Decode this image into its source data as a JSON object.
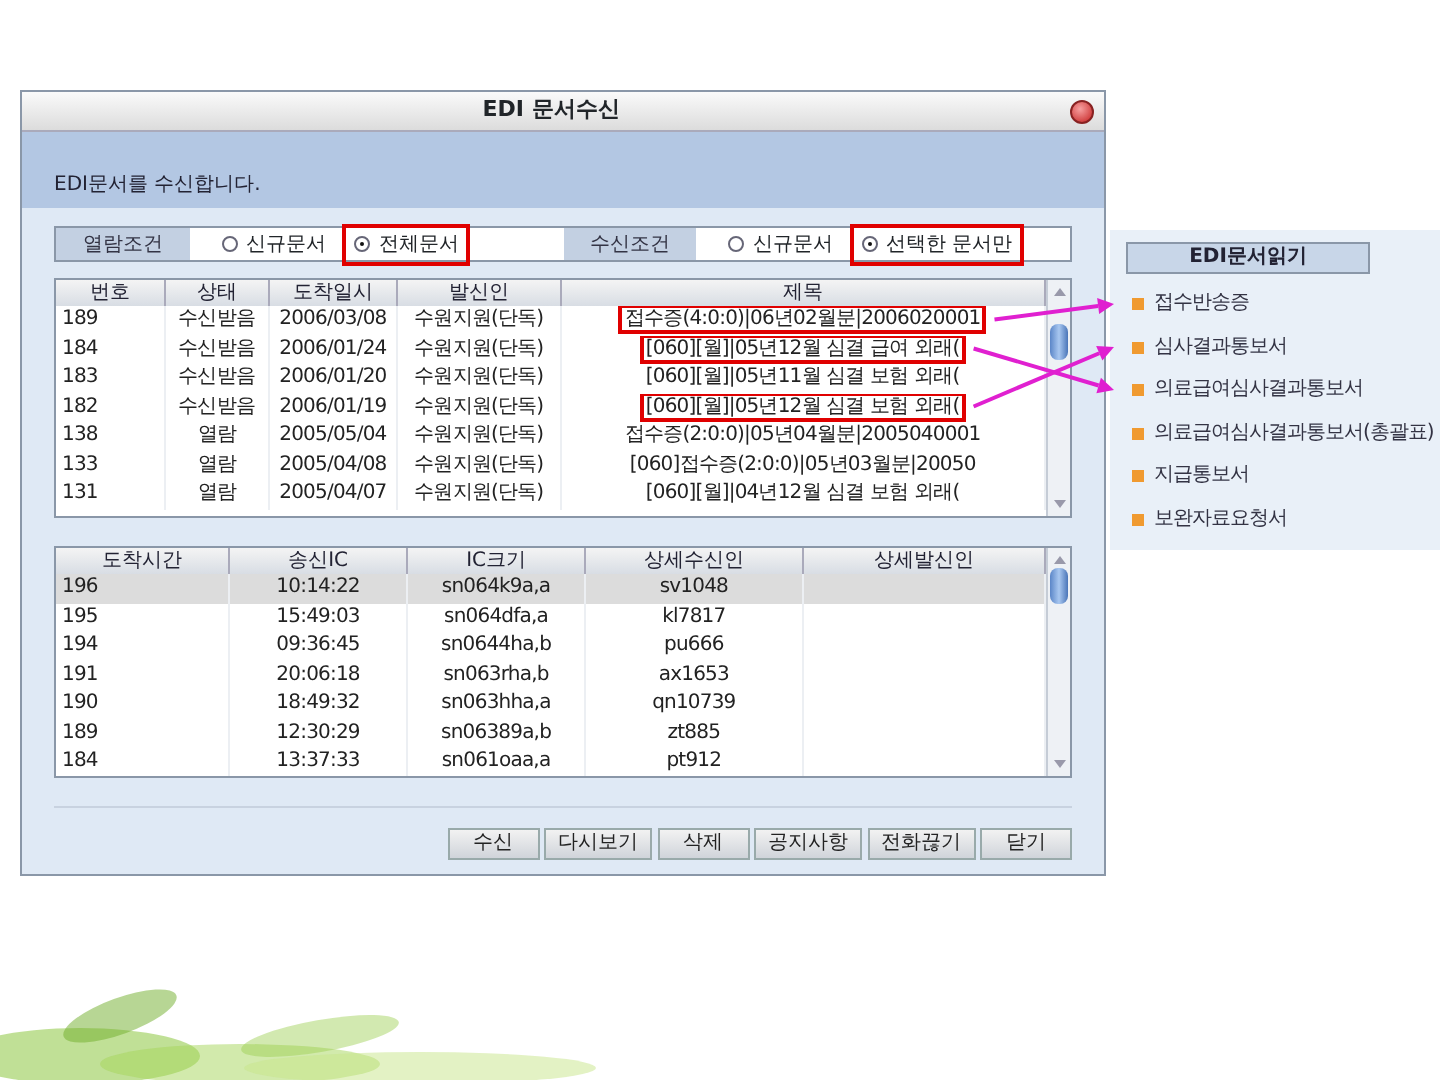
{
  "window": {
    "title": "EDI 문서수신"
  },
  "header": {
    "message": "EDI문서를 수신합니다."
  },
  "filters": [
    {
      "label": "열람조건",
      "options": [
        {
          "label": "신규문서",
          "selected": false,
          "highlighted": false
        },
        {
          "label": "전체문서",
          "selected": true,
          "highlighted": true
        }
      ]
    },
    {
      "label": "수신조건",
      "options": [
        {
          "label": "신규문서",
          "selected": false,
          "highlighted": false
        },
        {
          "label": "선택한 문서만",
          "selected": true,
          "highlighted": true
        }
      ]
    }
  ],
  "documents_table": {
    "columns": [
      "번호",
      "상태",
      "도착일시",
      "발신인",
      "제목"
    ],
    "rows": [
      {
        "cells": [
          "189",
          "수신받음",
          "2006/03/08",
          "수원지원(단독)",
          "접수증(4:0:0)|06년02월분|2006020001"
        ],
        "highlighted": true
      },
      {
        "cells": [
          "184",
          "수신받음",
          "2006/01/24",
          "수원지원(단독)",
          "[060][월]|05년12월 심결 급여 외래("
        ],
        "highlighted": true
      },
      {
        "cells": [
          "183",
          "수신받음",
          "2006/01/20",
          "수원지원(단독)",
          "[060][월]|05년11월 심결 보험 외래("
        ],
        "highlighted": false
      },
      {
        "cells": [
          "182",
          "수신받음",
          "2006/01/19",
          "수원지원(단독)",
          "[060][월]|05년12월 심결 보험 외래("
        ],
        "highlighted": true
      },
      {
        "cells": [
          "138",
          "열람",
          "2005/05/04",
          "수원지원(단독)",
          "접수증(2:0:0)|05년04월분|2005040001"
        ],
        "highlighted": false
      },
      {
        "cells": [
          "133",
          "열람",
          "2005/04/08",
          "수원지원(단독)",
          "[060]접수증(2:0:0)|05년03월분|20050"
        ],
        "highlighted": false
      },
      {
        "cells": [
          "131",
          "열람",
          "2005/04/07",
          "수원지원(단독)",
          "[060][월]|04년12월 심결 보험 외래("
        ],
        "highlighted": false
      }
    ]
  },
  "detail_table": {
    "columns": [
      "도착시간",
      "송신IC",
      "IC크기",
      "상세수신인",
      "상세발신인"
    ],
    "rows": [
      {
        "cells": [
          "196",
          "10:14:22",
          "sn064k9a,a",
          "sv1048"
        ],
        "selected": true
      },
      {
        "cells": [
          "195",
          "15:49:03",
          "sn064dfa,a",
          "kl7817"
        ],
        "selected": false
      },
      {
        "cells": [
          "194",
          "09:36:45",
          "sn0644ha,b",
          "pu666"
        ],
        "selected": false
      },
      {
        "cells": [
          "191",
          "20:06:18",
          "sn063rha,b",
          "ax1653"
        ],
        "selected": false
      },
      {
        "cells": [
          "190",
          "18:49:32",
          "sn063hha,a",
          "qn10739"
        ],
        "selected": false
      },
      {
        "cells": [
          "189",
          "12:30:29",
          "sn06389a,b",
          "zt885"
        ],
        "selected": false
      },
      {
        "cells": [
          "184",
          "13:37:33",
          "sn061oaa,a",
          "pt912"
        ],
        "selected": false
      }
    ]
  },
  "buttons": [
    "수신",
    "다시보기",
    "삭제",
    "공지사항",
    "전화끊기",
    "닫기"
  ],
  "reader_panel": {
    "title": "EDI문서읽기",
    "items": [
      "접수반송증",
      "심사결과통보서",
      "의료급여심사결과통보서",
      "의료급여심사결과통보서(총괄표)",
      "지급통보서",
      "보완자료요청서"
    ]
  }
}
